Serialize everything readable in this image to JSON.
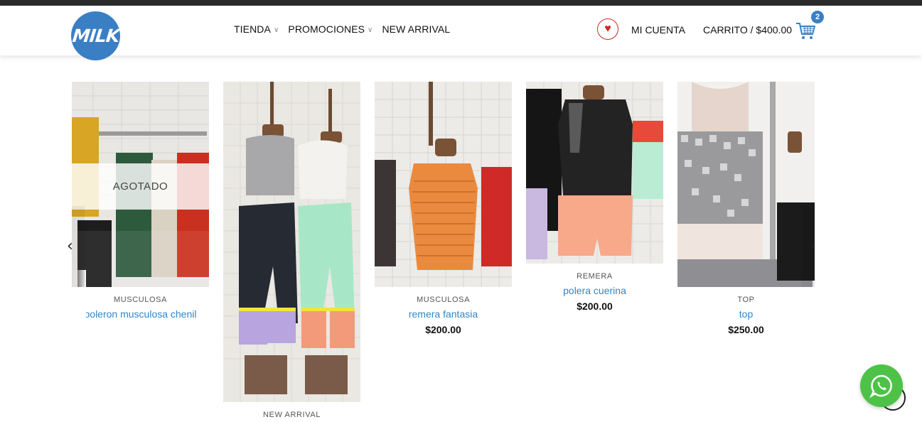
{
  "header": {
    "logo_text": "MILK",
    "nav": [
      {
        "label": "TIENDA",
        "dropdown": true
      },
      {
        "label": "PROMOCIONES",
        "dropdown": true
      },
      {
        "label": "NEW ARRIVAL",
        "dropdown": false
      }
    ],
    "account_label": "MI CUENTA",
    "cart_label": "CARRITO / $400.00",
    "cart_count": "2"
  },
  "products": [
    {
      "category": "MUSCULOSA",
      "name": "poleron musculosa chenil",
      "price": "",
      "badge": "AGOTADO"
    },
    {
      "category": "NEW ARRIVAL",
      "name": "",
      "price": "",
      "badge": ""
    },
    {
      "category": "MUSCULOSA",
      "name": "remera fantasia",
      "price": "$200.00",
      "badge": ""
    },
    {
      "category": "REMERA",
      "name": "polera cuerina",
      "price": "$200.00",
      "badge": ""
    },
    {
      "category": "TOP",
      "name": "top",
      "price": "$250.00",
      "badge": ""
    }
  ],
  "colors": {
    "brand_blue": "#3a7fc4",
    "link_blue": "#2f87c7",
    "heart_red": "#d02525",
    "whatsapp_green": "#4dc247"
  },
  "icons": {
    "heart": "heart-icon",
    "cart": "shopping-cart-icon",
    "prev": "chevron-left-icon",
    "next": "chevron-right-icon",
    "whatsapp": "whatsapp-icon",
    "back_to_top": "back-to-top-icon"
  }
}
